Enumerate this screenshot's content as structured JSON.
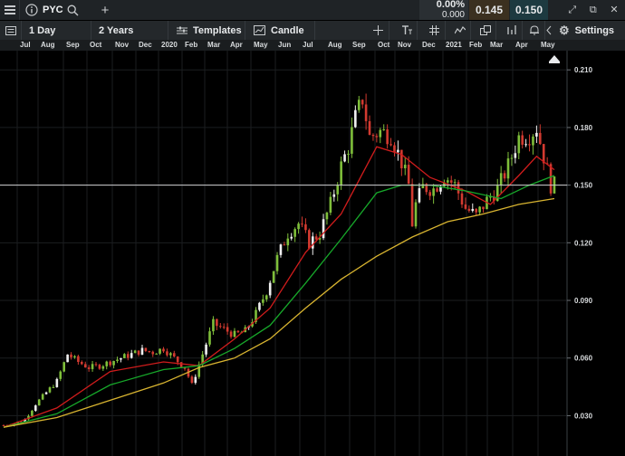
{
  "header": {
    "symbol": "PYC",
    "change_percent": "0.00%",
    "change_value": "0.000",
    "bid": "0.145",
    "ask": "0.150",
    "icons": [
      "menu-icon",
      "info-icon",
      "search-icon",
      "plus-icon",
      "expand-icon",
      "detach-icon",
      "close-icon"
    ]
  },
  "toolbar": {
    "interval": "1 Day",
    "range": "2 Years",
    "templates": "Templates",
    "chart_type": "Candle",
    "settings": "Settings",
    "icons": [
      "panel-icon",
      "layout-icon",
      "drawing-icon",
      "crosshair-icon",
      "text-icon",
      "grid-icon",
      "studies-icon",
      "windows-icon",
      "trade-icon",
      "alerts-icon",
      "back-icon",
      "gear-icon"
    ]
  },
  "colors": {
    "bull": "#7fbf3a",
    "bull_alt": "#f0f0f0",
    "bear": "#d23a30",
    "ma_fast": "#d01c1c",
    "ma_mid": "#17a82a",
    "ma_slow": "#d8b430",
    "price_line": "#d0d0d0"
  },
  "chart_data": {
    "type": "candlestick",
    "x_tick_labels": [
      "Jul",
      "Aug",
      "Sep",
      "Oct",
      "Nov",
      "Dec",
      "2020",
      "Feb",
      "Mar",
      "Apr",
      "May",
      "Jun",
      "Jul",
      "Aug",
      "Sep",
      "Oct",
      "Nov",
      "Dec",
      "2021",
      "Feb",
      "Mar",
      "Apr",
      "May"
    ],
    "y_tick_labels": [
      "0.210",
      "0.180",
      "0.150",
      "0.120",
      "0.090",
      "0.060",
      "0.030"
    ],
    "ylim": [
      0.009,
      0.22
    ],
    "last_price": 0.15,
    "close_path": [
      [
        0,
        0.025
      ],
      [
        3,
        0.026
      ],
      [
        6,
        0.028
      ],
      [
        9,
        0.036
      ],
      [
        12,
        0.042
      ],
      [
        15,
        0.048
      ],
      [
        18,
        0.062
      ],
      [
        21,
        0.058
      ],
      [
        24,
        0.055
      ],
      [
        27,
        0.056
      ],
      [
        30,
        0.058
      ],
      [
        33,
        0.06
      ],
      [
        36,
        0.062
      ],
      [
        39,
        0.064
      ],
      [
        42,
        0.063
      ],
      [
        45,
        0.065
      ],
      [
        48,
        0.06
      ],
      [
        51,
        0.055
      ],
      [
        53,
        0.046
      ],
      [
        56,
        0.062
      ],
      [
        59,
        0.078
      ],
      [
        62,
        0.075
      ],
      [
        65,
        0.072
      ],
      [
        68,
        0.074
      ],
      [
        71,
        0.083
      ],
      [
        74,
        0.095
      ],
      [
        77,
        0.112
      ],
      [
        80,
        0.125
      ],
      [
        83,
        0.13
      ],
      [
        86,
        0.12
      ],
      [
        89,
        0.125
      ],
      [
        92,
        0.14
      ],
      [
        95,
        0.16
      ],
      [
        97,
        0.17
      ],
      [
        99,
        0.185
      ],
      [
        101,
        0.195
      ],
      [
        103,
        0.175
      ],
      [
        106,
        0.178
      ],
      [
        109,
        0.176
      ],
      [
        112,
        0.162
      ],
      [
        114,
        0.15
      ],
      [
        115,
        0.13
      ],
      [
        116,
        0.14
      ],
      [
        118,
        0.149
      ],
      [
        121,
        0.148
      ],
      [
        124,
        0.155
      ],
      [
        127,
        0.15
      ],
      [
        130,
        0.138
      ],
      [
        133,
        0.134
      ],
      [
        136,
        0.142
      ],
      [
        139,
        0.148
      ],
      [
        142,
        0.16
      ],
      [
        145,
        0.175
      ],
      [
        148,
        0.176
      ],
      [
        150,
        0.18
      ],
      [
        152,
        0.165
      ],
      [
        154,
        0.15
      ],
      [
        155,
        0.15
      ]
    ],
    "moving_averages": [
      {
        "style": "ma_fast",
        "points": [
          [
            0,
            0.024
          ],
          [
            15,
            0.034
          ],
          [
            30,
            0.053
          ],
          [
            45,
            0.058
          ],
          [
            55,
            0.056
          ],
          [
            65,
            0.07
          ],
          [
            75,
            0.086
          ],
          [
            85,
            0.115
          ],
          [
            95,
            0.135
          ],
          [
            105,
            0.17
          ],
          [
            112,
            0.166
          ],
          [
            120,
            0.154
          ],
          [
            130,
            0.147
          ],
          [
            137,
            0.14
          ],
          [
            145,
            0.155
          ],
          [
            150,
            0.165
          ],
          [
            155,
            0.158
          ]
        ]
      },
      {
        "style": "ma_mid",
        "points": [
          [
            0,
            0.024
          ],
          [
            15,
            0.031
          ],
          [
            30,
            0.046
          ],
          [
            45,
            0.054
          ],
          [
            55,
            0.056
          ],
          [
            65,
            0.065
          ],
          [
            75,
            0.077
          ],
          [
            85,
            0.099
          ],
          [
            95,
            0.122
          ],
          [
            105,
            0.146
          ],
          [
            112,
            0.15
          ],
          [
            120,
            0.15
          ],
          [
            130,
            0.147
          ],
          [
            140,
            0.143
          ],
          [
            148,
            0.15
          ],
          [
            155,
            0.155
          ]
        ]
      },
      {
        "style": "ma_slow",
        "points": [
          [
            0,
            0.024
          ],
          [
            15,
            0.029
          ],
          [
            30,
            0.038
          ],
          [
            45,
            0.047
          ],
          [
            55,
            0.055
          ],
          [
            65,
            0.06
          ],
          [
            75,
            0.07
          ],
          [
            85,
            0.086
          ],
          [
            95,
            0.101
          ],
          [
            105,
            0.113
          ],
          [
            115,
            0.123
          ],
          [
            125,
            0.131
          ],
          [
            135,
            0.135
          ],
          [
            145,
            0.14
          ],
          [
            155,
            0.143
          ]
        ]
      }
    ]
  }
}
